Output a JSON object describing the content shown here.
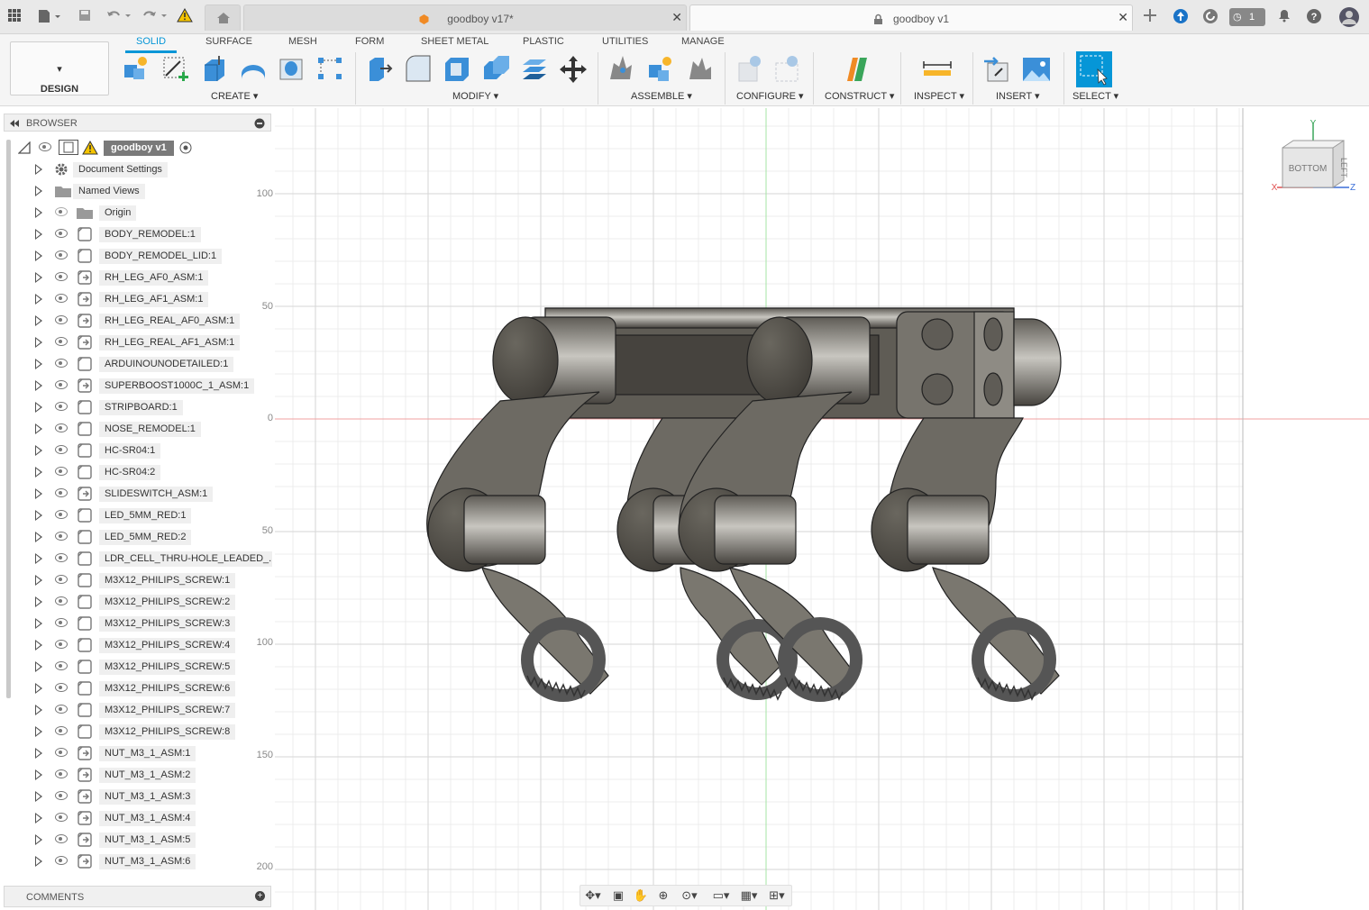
{
  "app": {
    "tabs": [
      {
        "label": "goodboy v17*",
        "active": false
      },
      {
        "label": "goodboy v1",
        "active": true
      }
    ],
    "job_badge": "1"
  },
  "ribbon": {
    "workspace": "DESIGN",
    "tabs": [
      "SOLID",
      "SURFACE",
      "MESH",
      "FORM",
      "SHEET METAL",
      "PLASTIC",
      "UTILITIES",
      "MANAGE"
    ],
    "active_tab": "SOLID",
    "groups": [
      "CREATE",
      "MODIFY",
      "ASSEMBLE",
      "CONFIGURE",
      "CONSTRUCT",
      "INSPECT",
      "INSERT",
      "SELECT"
    ]
  },
  "browser": {
    "title": "BROWSER",
    "root": "goodboy v1",
    "items": [
      {
        "label": "Document Settings",
        "kind": "settings"
      },
      {
        "label": "Named Views",
        "kind": "folder"
      },
      {
        "label": "Origin",
        "kind": "folder-hidden"
      },
      {
        "label": "BODY_REMODEL:1",
        "kind": "comp"
      },
      {
        "label": "BODY_REMODEL_LID:1",
        "kind": "comp"
      },
      {
        "label": "RH_LEG_AF0_ASM:1",
        "kind": "link"
      },
      {
        "label": "RH_LEG_AF1_ASM:1",
        "kind": "link"
      },
      {
        "label": "RH_LEG_REAL_AF0_ASM:1",
        "kind": "link"
      },
      {
        "label": "RH_LEG_REAL_AF1_ASM:1",
        "kind": "link"
      },
      {
        "label": "ARDUINOUNODETAILED:1",
        "kind": "comp"
      },
      {
        "label": "SUPERBOOST1000C_1_ASM:1",
        "kind": "link"
      },
      {
        "label": "STRIPBOARD:1",
        "kind": "comp"
      },
      {
        "label": "NOSE_REMODEL:1",
        "kind": "comp"
      },
      {
        "label": "HC-SR04:1",
        "kind": "comp"
      },
      {
        "label": "HC-SR04:2",
        "kind": "comp"
      },
      {
        "label": "SLIDESWITCH_ASM:1",
        "kind": "link"
      },
      {
        "label": "LED_5MM_RED:1",
        "kind": "comp"
      },
      {
        "label": "LED_5MM_RED:2",
        "kind": "comp"
      },
      {
        "label": "LDR_CELL_THRU-HOLE_LEADED_...",
        "kind": "comp"
      },
      {
        "label": "M3X12_PHILIPS_SCREW:1",
        "kind": "comp"
      },
      {
        "label": "M3X12_PHILIPS_SCREW:2",
        "kind": "comp"
      },
      {
        "label": "M3X12_PHILIPS_SCREW:3",
        "kind": "comp"
      },
      {
        "label": "M3X12_PHILIPS_SCREW:4",
        "kind": "comp"
      },
      {
        "label": "M3X12_PHILIPS_SCREW:5",
        "kind": "comp"
      },
      {
        "label": "M3X12_PHILIPS_SCREW:6",
        "kind": "comp"
      },
      {
        "label": "M3X12_PHILIPS_SCREW:7",
        "kind": "comp"
      },
      {
        "label": "M3X12_PHILIPS_SCREW:8",
        "kind": "comp"
      },
      {
        "label": "NUT_M3_1_ASM:1",
        "kind": "link"
      },
      {
        "label": "NUT_M3_1_ASM:2",
        "kind": "link"
      },
      {
        "label": "NUT_M3_1_ASM:3",
        "kind": "link"
      },
      {
        "label": "NUT_M3_1_ASM:4",
        "kind": "link"
      },
      {
        "label": "NUT_M3_1_ASM:5",
        "kind": "link"
      },
      {
        "label": "NUT_M3_1_ASM:6",
        "kind": "link"
      }
    ]
  },
  "comments": {
    "title": "COMMENTS"
  },
  "viewport": {
    "axis_labels": [
      "100",
      "50",
      "0",
      "50",
      "100",
      "150",
      "200"
    ],
    "viewcube": {
      "face_front": "BOTTOM",
      "face_side": "LEFT",
      "axis_x": "X",
      "axis_y": "Y",
      "axis_z": "Z"
    }
  },
  "colors": {
    "accent": "#0696d7",
    "model": "#5a5750",
    "grid": "#e3e3e3",
    "red_axis": "#f08080",
    "green_axis": "#90e090"
  }
}
